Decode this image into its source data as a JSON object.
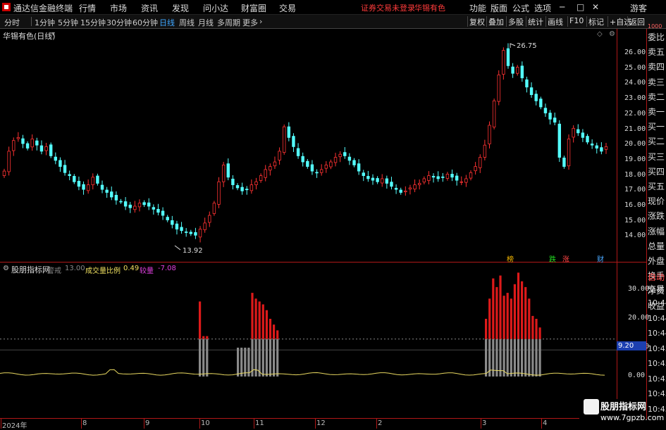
{
  "menubar": {
    "app_title": "通达信金融终端",
    "items": [
      "行情",
      "市场",
      "资讯",
      "发现",
      "问小达",
      "财富圈",
      "交易"
    ],
    "warning": "证券交易未登录",
    "stock_name": "华锡有色",
    "right_items": [
      "功能",
      "版面",
      "公式",
      "选项"
    ],
    "user": "游客"
  },
  "toolbar": {
    "periods": [
      "分时",
      "1分钟",
      "5分钟",
      "15分钟",
      "30分钟",
      "60分钟",
      "日线",
      "周线",
      "月线",
      "多周期",
      "更多"
    ],
    "active_period": "日线",
    "right_buttons": [
      "复权",
      "叠加",
      "多股",
      "统计",
      "画线",
      "F10",
      "标记",
      "+自选",
      "返回"
    ]
  },
  "main_chart": {
    "title": "华锡有色(日线)",
    "high_label": "26.75",
    "low_label": "13.92",
    "y_ticks": [
      "26.00",
      "25.00",
      "24.00",
      "23.00",
      "22.00",
      "21.00",
      "20.00",
      "19.00",
      "18.00",
      "17.00",
      "16.00",
      "15.00",
      "14.00"
    ],
    "markers": [
      "榜",
      "跌",
      "涨",
      "财"
    ]
  },
  "sub_chart": {
    "title": "股朋指标网",
    "legend_warning_label": "警戒",
    "legend_warning_value": "13.00",
    "legend_ratio_label": "成交量比例",
    "legend_ratio_value": "0.49",
    "legend_vol_label": "较量",
    "legend_vol_value": "-7.08",
    "y_ticks": [
      "30.00",
      "20.00",
      "10.00",
      "0.00"
    ],
    "current_value": "9.20"
  },
  "x_dates": [
    "2024年",
    "8",
    "9",
    "10",
    "11",
    "12",
    "2",
    "3",
    "4"
  ],
  "side_panel": {
    "items": [
      "委比",
      "卖五",
      "卖四",
      "卖三",
      "卖二",
      "卖一",
      "买一",
      "买二",
      "买三",
      "买四",
      "买五",
      "现价",
      "涨跌",
      "涨幅",
      "总量",
      "外盘",
      "换手",
      "净资",
      "收益"
    ],
    "auto_label": "自动",
    "trade_label": "交易",
    "times": [
      "10:44",
      "10:44",
      "10:44",
      "10:45",
      "10:45",
      "10:45",
      "10:45",
      "10:45"
    ],
    "top_small": "1000"
  },
  "watermark": {
    "title": "股朋指标网",
    "url": "www.7gpzb.com"
  },
  "colors": {
    "up": "#ff3232",
    "down": "#54ffff",
    "axis": "#b01818",
    "active": "#3ea6ff"
  },
  "icons": [
    "settings-icon",
    "dropdown-icon"
  ],
  "chart_data": [
    {
      "type": "candlestick",
      "title": "华锡有色(日线)",
      "x_range": [
        "2024-07",
        "2025-04"
      ],
      "ylim": [
        14.0,
        26.75
      ],
      "annotations": [
        {
          "label": "26.75",
          "kind": "high"
        },
        {
          "label": "13.92",
          "kind": "low"
        }
      ],
      "close": [
        18.3,
        19.6,
        20.3,
        20.5,
        20.1,
        19.8,
        20.4,
        20.0,
        19.6,
        19.9,
        19.3,
        19.0,
        18.6,
        18.2,
        18.0,
        17.6,
        17.3,
        17.1,
        17.4,
        17.9,
        17.5,
        17.1,
        16.9,
        16.6,
        16.4,
        16.3,
        16.0,
        15.9,
        16.0,
        16.2,
        16.1,
        16.0,
        15.8,
        15.6,
        15.4,
        15.1,
        14.8,
        14.5,
        14.4,
        14.3,
        14.2,
        14.1,
        14.5,
        14.9,
        15.4,
        16.2,
        17.6,
        18.7,
        17.9,
        17.4,
        17.2,
        17.0,
        17.1,
        17.4,
        17.6,
        18.0,
        18.4,
        18.6,
        18.9,
        19.6,
        21.2,
        20.5,
        19.9,
        19.3,
        18.9,
        18.6,
        18.3,
        18.2,
        18.4,
        18.7,
        18.9,
        19.2,
        19.4,
        19.3,
        19.0,
        18.7,
        18.3,
        18.0,
        17.8,
        17.7,
        17.6,
        17.8,
        17.5,
        17.3,
        17.1,
        16.9,
        17.0,
        17.2,
        17.4,
        17.5,
        17.8,
        18.0,
        17.9,
        17.8,
        17.9,
        18.1,
        17.9,
        17.7,
        17.6,
        17.8,
        18.2,
        18.6,
        19.2,
        20.0,
        21.3,
        22.9,
        24.6,
        26.2,
        25.2,
        24.7,
        25.1,
        24.4,
        23.8,
        23.3,
        22.9,
        22.5,
        22.1,
        21.7,
        21.5,
        19.2,
        18.6,
        20.4,
        21.1,
        20.8,
        20.5,
        20.2,
        20.0,
        19.8,
        19.6,
        19.9
      ]
    },
    {
      "type": "bar",
      "title": "股朋指标网",
      "reference_line": 13.0,
      "ylim": [
        0,
        33
      ],
      "series": [
        {
          "name": "成交量比例",
          "last": 0.49
        },
        {
          "name": "较量",
          "last": -7.08
        }
      ],
      "current": 9.2,
      "bars": [
        {
          "group": 1,
          "values": [
            26,
            14,
            14
          ]
        },
        {
          "group": 2,
          "values": [
            10,
            10,
            10,
            10,
            29,
            27,
            26,
            25,
            23,
            20,
            18,
            16
          ]
        },
        {
          "group": 3,
          "values": [
            20,
            27,
            34,
            31,
            35,
            28,
            29,
            27,
            32,
            36,
            33,
            31,
            27,
            21,
            20,
            17
          ]
        }
      ]
    }
  ]
}
